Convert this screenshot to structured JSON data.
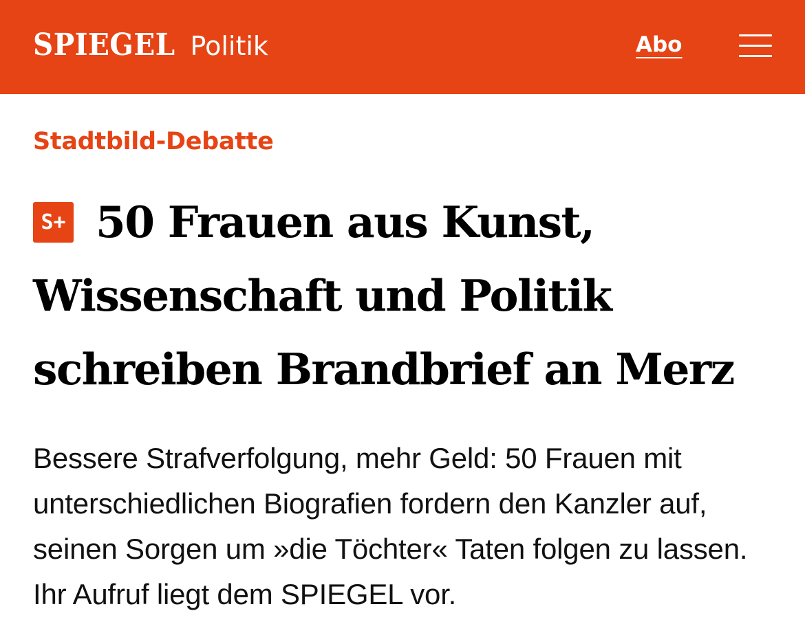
{
  "header": {
    "logo": "SPIEGEL",
    "section": "Politik",
    "abo_label": "Abo",
    "menu_icon": "hamburger-menu-icon",
    "background_color": "#e64415"
  },
  "article": {
    "kicker": "Stadtbild-Debatte",
    "badge": "S+",
    "headline": "50 Frauen aus Kunst, Wissenschaft und Politik schreiben Brandbrief an Merz",
    "teaser": "Bessere Strafverfolgung, mehr Geld: 50 Frauen mit unterschiedlichen Biografien fordern den Kanzler auf, seinen Sorgen um »die Töchter« Taten folgen zu lassen. Ihr Aufruf liegt dem SPIEGEL vor.",
    "accent_color": "#e64415"
  }
}
